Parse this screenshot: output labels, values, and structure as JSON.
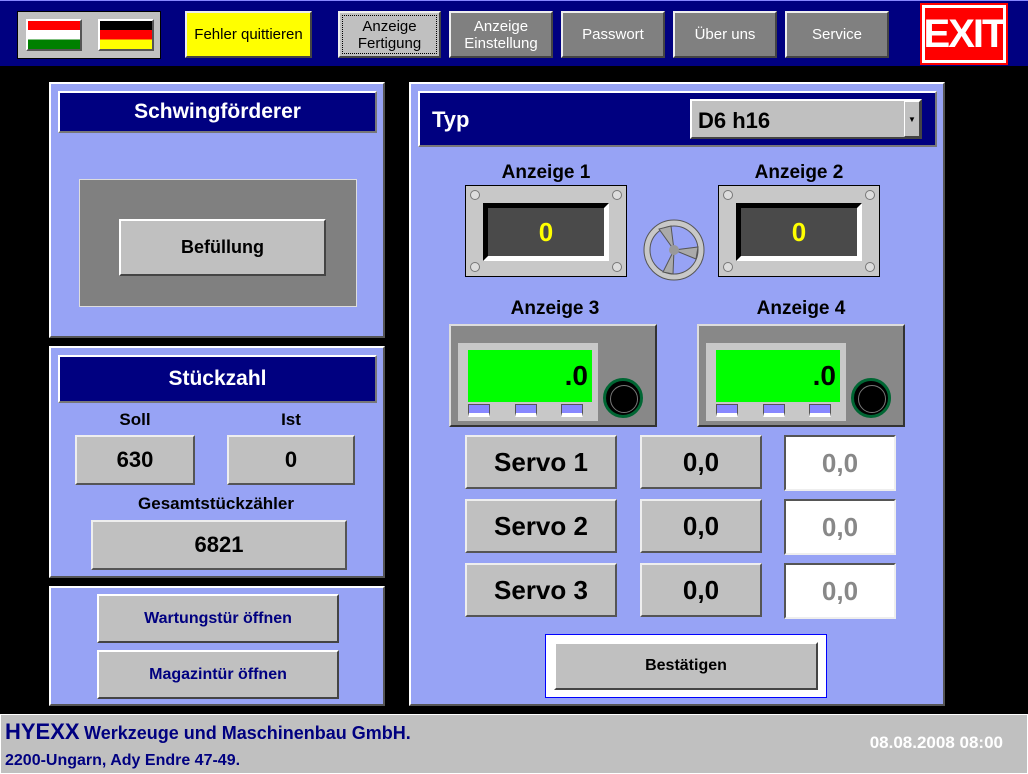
{
  "topbar": {
    "flags": [
      {
        "name": "hungarian-flag",
        "colors": [
          "#ff0000",
          "#ffffff",
          "#008000"
        ]
      },
      {
        "name": "german-flag",
        "colors": [
          "#000000",
          "#ff0000",
          "#ffff00"
        ]
      }
    ],
    "fehler_quittieren": "Fehler quittieren",
    "nav": [
      "Anzeige Fertigung",
      "Anzeige Einstellung",
      "Passwort",
      "Über uns",
      "Service"
    ],
    "exit": "EXIT"
  },
  "left": {
    "schwing_title": "Schwingförderer",
    "befuellung": "Befüllung",
    "stueck_title": "Stückzahl",
    "soll_label": "Soll",
    "ist_label": "Ist",
    "soll": "630",
    "ist": "0",
    "gesamt_label": "Gesamtstückzähler",
    "gesamt": "6821",
    "wartung": "Wartungstür öffnen",
    "magazin": "Magazintür öffnen"
  },
  "right": {
    "typ_label": "Typ",
    "typ_value": "D6 h16",
    "meters": [
      {
        "label": "Anzeige 1",
        "value": "0"
      },
      {
        "label": "Anzeige 2",
        "value": "0"
      },
      {
        "label": "Anzeige 3",
        "value": ".0"
      },
      {
        "label": "Anzeige 4",
        "value": ".0"
      }
    ],
    "servos": [
      {
        "label": "Servo 1",
        "ist": "0,0",
        "soll": "0,0"
      },
      {
        "label": "Servo 2",
        "ist": "0,0",
        "soll": "0,0"
      },
      {
        "label": "Servo 3",
        "ist": "0,0",
        "soll": "0,0"
      }
    ],
    "bestaetigen": "Bestätigen"
  },
  "footer": {
    "company_brand": "HYEXX",
    "company_rest": "Werkzeuge und Maschinenbau GmbH.",
    "address": "2200-Ungarn, Ady Endre 47-49.",
    "datetime": "08.08.2008 08:00"
  },
  "colors": {
    "navy": "#000080",
    "panel": "#97a3f5",
    "lcd": "#00ff00",
    "warning": "#ffff00",
    "exit": "#ff0000"
  }
}
